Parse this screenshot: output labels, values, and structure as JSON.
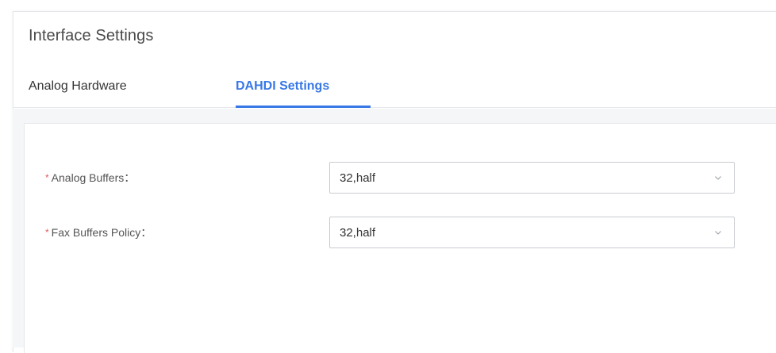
{
  "header": {
    "title": "Interface Settings"
  },
  "tabs": [
    {
      "label": "Analog Hardware",
      "active": false
    },
    {
      "label": "DAHDI Settings",
      "active": true
    }
  ],
  "form": {
    "required_mark": "*",
    "fields": [
      {
        "label": "Analog Buffers：",
        "value": "32,half"
      },
      {
        "label": "Fax Buffers Policy：",
        "value": "32,half"
      }
    ]
  },
  "colors": {
    "accent": "#3877e6",
    "required": "#e55a5a",
    "text": "#333333"
  },
  "icons": {
    "dropdown": "chevron-down-icon"
  }
}
